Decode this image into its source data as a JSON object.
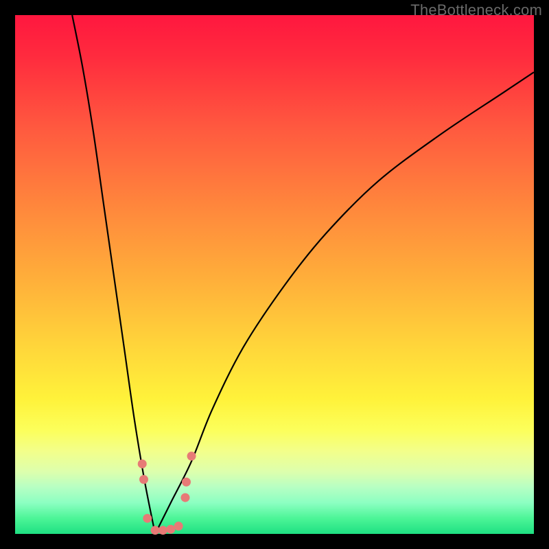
{
  "watermark": "TheBottleneck.com",
  "colors": {
    "background": "#000000",
    "curve_stroke": "#000000",
    "dot_fill": "#e77a76",
    "gradient_top": "#ff173f",
    "gradient_bottom": "#1ee082"
  },
  "chart_data": {
    "type": "line",
    "title": "",
    "xlabel": "",
    "ylabel": "",
    "xlim": [
      0,
      100
    ],
    "ylim": [
      0,
      100
    ],
    "grid": false,
    "legend": false,
    "notes": "Two black curves descending to a shared minimum near x≈27 (y=0) on a vertical red→green gradient. Pink dots cluster around the valley bottom.",
    "series": [
      {
        "name": "left-curve",
        "x": [
          11,
          13,
          15,
          17,
          19,
          21,
          23,
          25,
          27
        ],
        "y": [
          100,
          90,
          78,
          64,
          50,
          36,
          22,
          10,
          0
        ]
      },
      {
        "name": "right-curve",
        "x": [
          27,
          30,
          34,
          38,
          44,
          52,
          60,
          70,
          82,
          94,
          100
        ],
        "y": [
          0,
          6,
          14,
          24,
          36,
          48,
          58,
          68,
          77,
          85,
          89
        ]
      }
    ],
    "dots": [
      {
        "x": 24.5,
        "y": 13.5
      },
      {
        "x": 24.8,
        "y": 10.5
      },
      {
        "x": 25.5,
        "y": 3.0
      },
      {
        "x": 27.0,
        "y": 0.7
      },
      {
        "x": 28.5,
        "y": 0.7
      },
      {
        "x": 30.0,
        "y": 0.9
      },
      {
        "x": 31.5,
        "y": 1.5
      },
      {
        "x": 32.8,
        "y": 7.0
      },
      {
        "x": 33.0,
        "y": 10.0
      },
      {
        "x": 34.0,
        "y": 15.0
      }
    ]
  }
}
